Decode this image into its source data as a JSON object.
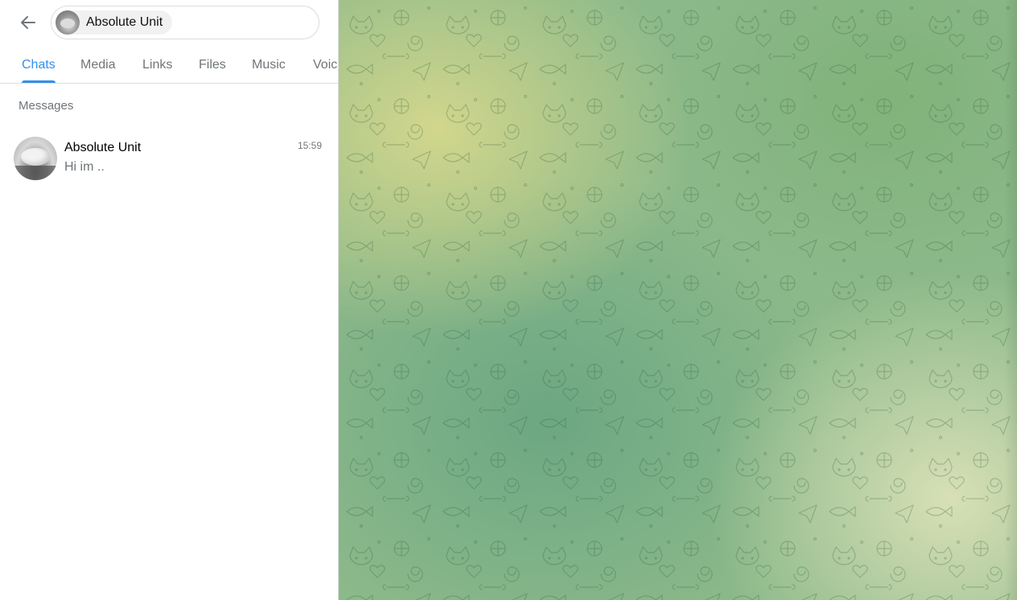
{
  "search": {
    "chip_label": "Absolute Unit"
  },
  "tabs": [
    {
      "label": "Chats",
      "active": true
    },
    {
      "label": "Media",
      "active": false
    },
    {
      "label": "Links",
      "active": false
    },
    {
      "label": "Files",
      "active": false
    },
    {
      "label": "Music",
      "active": false
    },
    {
      "label": "Voic",
      "active": false
    }
  ],
  "section": {
    "title": "Messages"
  },
  "results": [
    {
      "name": "Absolute Unit",
      "time": "15:59",
      "preview": "Hi im .."
    }
  ],
  "icons": {
    "back": "arrow-left-icon",
    "wallpaper": "doodle-pattern"
  },
  "colors": {
    "accent": "#3390ec",
    "secondary_text": "#707579",
    "wallpaper_base": "#8cb98a"
  }
}
